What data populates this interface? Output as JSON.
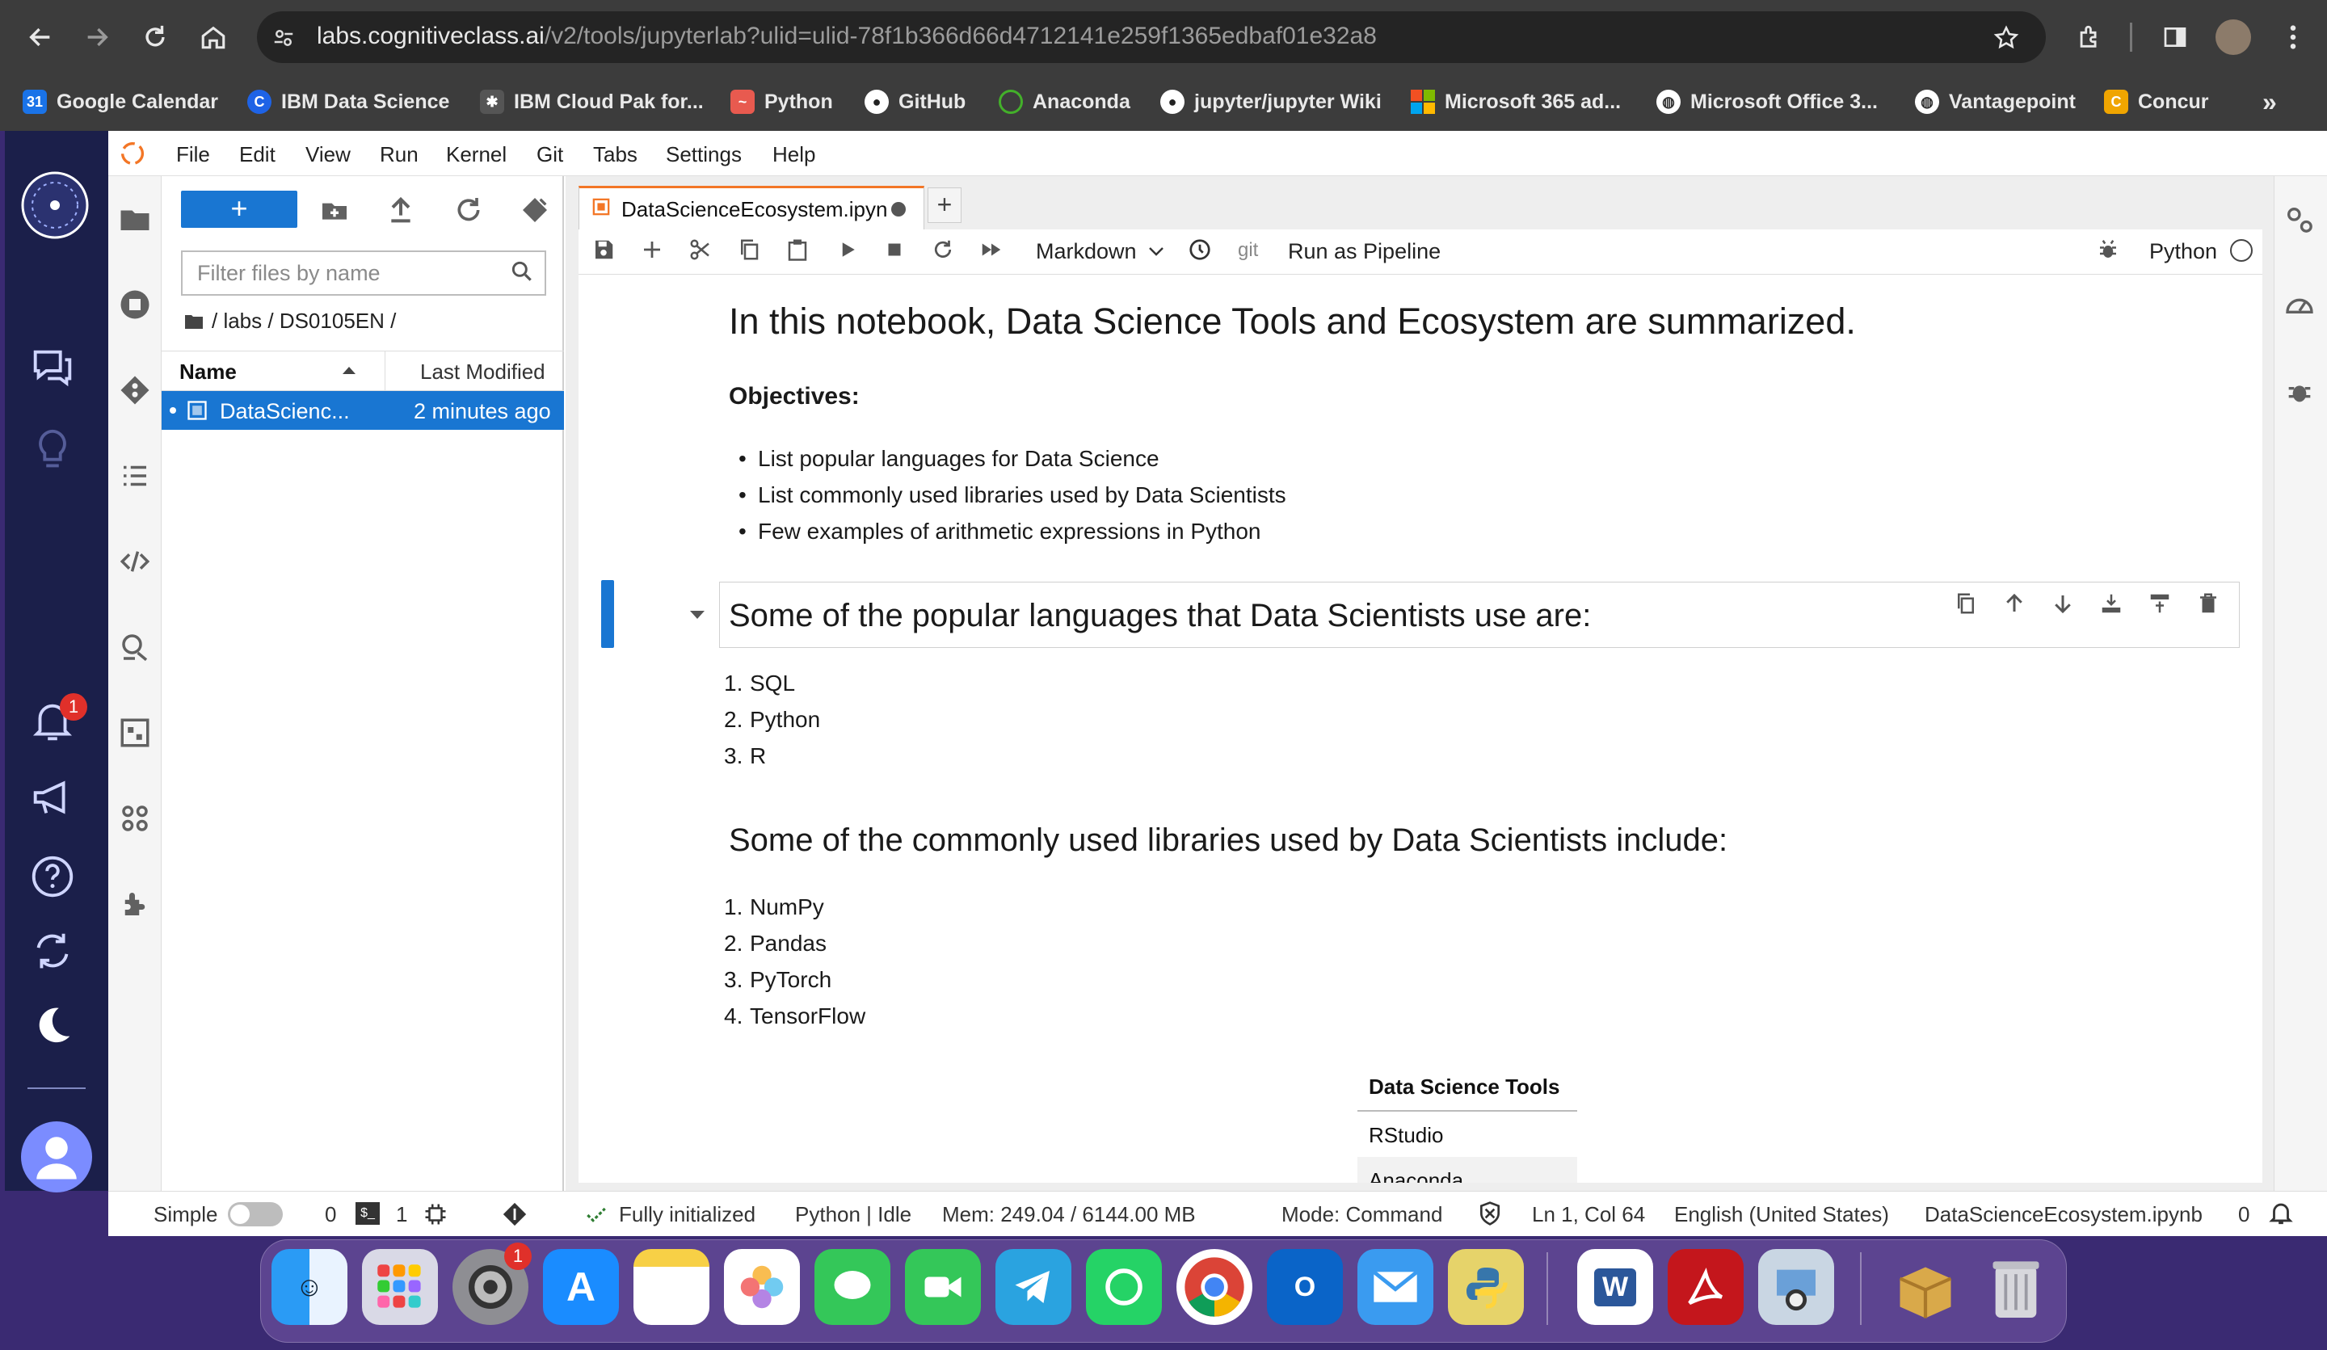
{
  "browser": {
    "url_host": "labs.cognitiveclass.ai",
    "url_path": "/v2/tools/jupyterlab?ulid=ulid-78f1b366d66d4712141e259f1365edbaf01e32a8",
    "bookmarks": [
      {
        "label": "Google Calendar",
        "icon": "calendar-icon",
        "color": "#1a73e8"
      },
      {
        "label": "IBM Data Science",
        "icon": "c-logo-icon",
        "color": "#1e63e6"
      },
      {
        "label": "IBM Cloud Pak for...",
        "icon": "bee-icon",
        "color": "#777777"
      },
      {
        "label": "Python",
        "icon": "python-icon",
        "color": "#e85a4f"
      },
      {
        "label": "GitHub",
        "icon": "github-icon",
        "color": "#ffffff"
      },
      {
        "label": "Anaconda",
        "icon": "anaconda-icon",
        "color": "#43b02a"
      },
      {
        "label": "jupyter/jupyter Wiki",
        "icon": "github-icon",
        "color": "#ffffff"
      },
      {
        "label": "Microsoft 365 ad...",
        "icon": "microsoft-icon",
        "color": "#f25022"
      },
      {
        "label": "Microsoft Office 3...",
        "icon": "globe-icon",
        "color": "#ffffff"
      },
      {
        "label": "Vantagepoint",
        "icon": "globe-icon",
        "color": "#ffffff"
      },
      {
        "label": "Concur",
        "icon": "concur-icon",
        "color": "#f0a500"
      }
    ]
  },
  "ibm_sidebar": {
    "notification_count": "1"
  },
  "menu": [
    "File",
    "Edit",
    "View",
    "Run",
    "Kernel",
    "Git",
    "Tabs",
    "Settings",
    "Help"
  ],
  "filebrowser": {
    "new_label": "+",
    "filter_placeholder": "Filter files by name",
    "breadcrumb": "/ labs / DS0105EN /",
    "col_name": "Name",
    "col_modified": "Last Modified",
    "files": [
      {
        "name": "DataScienc...",
        "modified": "2 minutes ago"
      }
    ]
  },
  "notebook": {
    "tab_title": "DataScienceEcosystem.ipyn",
    "cell_type": "Markdown",
    "git_label": "git",
    "pipeline_label": "Run as Pipeline",
    "kernel": "Python",
    "title": "In this notebook, Data Science Tools and Ecosystem are summarized.",
    "objectives_heading": "Objectives:",
    "objectives": [
      "List popular languages for Data Science",
      "List commonly used libraries used by Data Scientists",
      "Few examples of arithmetic expressions in Python"
    ],
    "languages_heading": "Some of the popular languages that Data Scientists use are:",
    "languages": [
      "SQL",
      "Python",
      "R"
    ],
    "libraries_heading": "Some of the commonly used libraries used by Data Scientists include:",
    "libraries": [
      "NumPy",
      "Pandas",
      "PyTorch",
      "TensorFlow"
    ],
    "tools_table": {
      "header": "Data Science Tools",
      "rows": [
        "RStudio",
        "Anaconda"
      ]
    }
  },
  "status": {
    "mode_toggle": "Simple",
    "terminals": "0",
    "kernels": "1",
    "init": "Fully initialized",
    "kernel_state": "Python | Idle",
    "memory": "Mem: 249.04 / 6144.00 MB",
    "mode": "Mode: Command",
    "cursor": "Ln 1, Col 64",
    "language": "English (United States)",
    "filename": "DataScienceEcosystem.ipynb",
    "notifications": "0"
  },
  "dock": {
    "apps": [
      "Finder",
      "Launchpad",
      "System Settings",
      "App Store",
      "Notes",
      "Photos",
      "Messages",
      "FaceTime",
      "Telegram",
      "WhatsApp",
      "Chrome",
      "Outlook",
      "Mail",
      "Python Launcher",
      "Word",
      "Acrobat",
      "Preview",
      "Archive Utility",
      "Trash"
    ],
    "settings_badge": "1"
  }
}
